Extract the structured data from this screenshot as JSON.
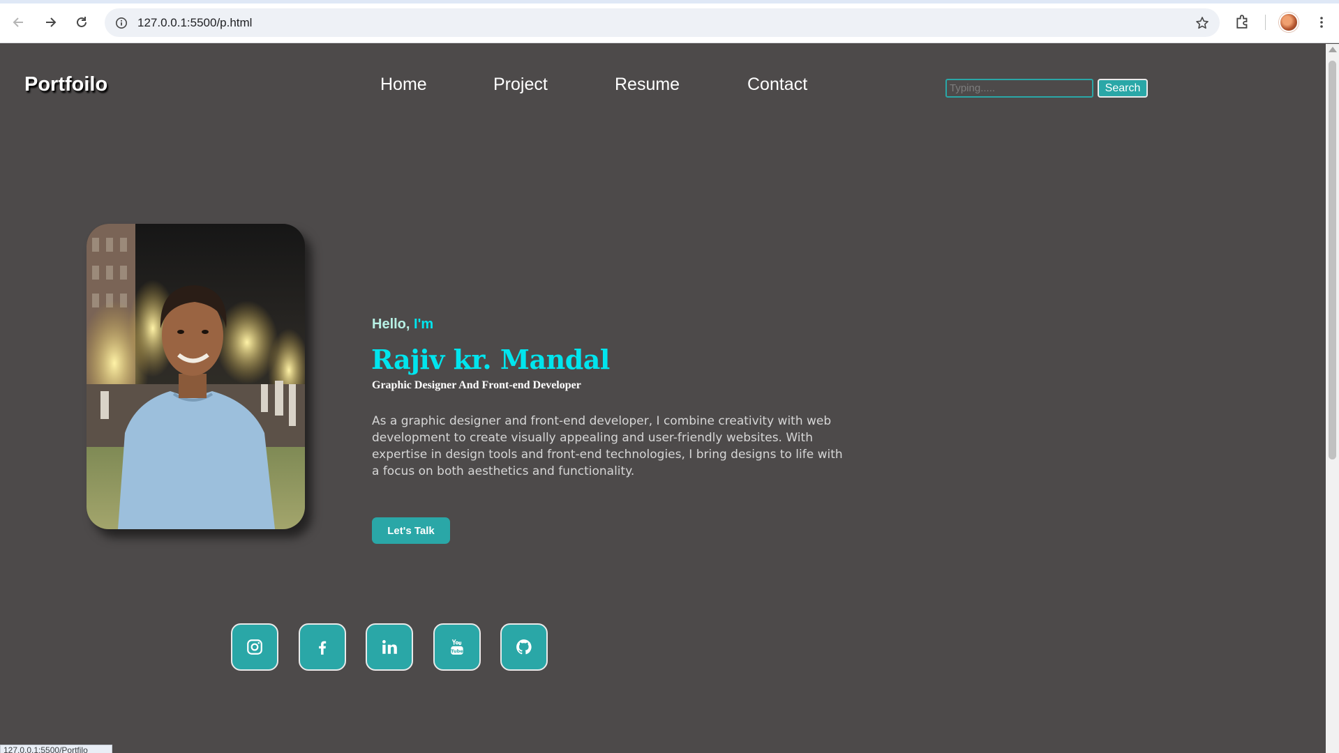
{
  "browser": {
    "url": "127.0.0.1:5500/p.html",
    "status_url": "127.0.0.1:5500/Portfilo"
  },
  "header": {
    "logo": "Portfoilo",
    "nav": [
      "Home",
      "Project",
      "Resume",
      "Contact"
    ],
    "search_placeholder": "Typing.....",
    "search_button": "Search"
  },
  "hero": {
    "hello": "Hello, ",
    "im": "I'm",
    "name": "Rajiv kr. Mandal",
    "tagline": "Graphic Designer And Front-end Developer",
    "bio": "As a graphic designer and front-end developer, I combine creativity with web development to create visually appealing and user-friendly websites. With expertise in design tools and front-end technologies, I bring designs to life with a focus on both aesthetics and functionality.",
    "cta": "Let's Talk"
  },
  "social": [
    "instagram-icon",
    "facebook-icon",
    "linkedin-icon",
    "youtube-icon",
    "github-icon"
  ],
  "colors": {
    "background": "#4d4a4a",
    "accent": "#2aa7a7",
    "name": "#00e5ee"
  }
}
